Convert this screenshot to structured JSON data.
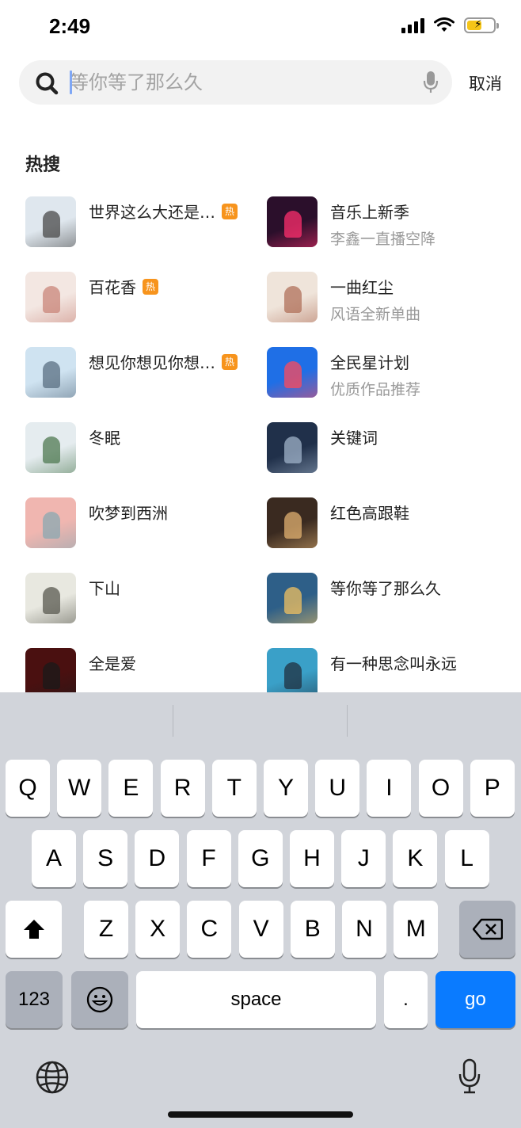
{
  "status": {
    "time": "2:49"
  },
  "search": {
    "placeholder": "等你等了那么久",
    "cancel_label": "取消"
  },
  "hot": {
    "title": "热搜",
    "badge_label": "热",
    "items": [
      {
        "title": "世界这么大还是…",
        "subtitle": "",
        "hot": true,
        "thumb_bg": "#dfe7ee",
        "thumb_accent": "#4a4a4a"
      },
      {
        "title": "音乐上新季",
        "subtitle": "李鑫一直播空降",
        "hot": false,
        "thumb_bg": "#2b0f2b",
        "thumb_accent": "#ff2f6d"
      },
      {
        "title": "百花香",
        "subtitle": "",
        "hot": true,
        "thumb_bg": "#f3e7e2",
        "thumb_accent": "#c9857a"
      },
      {
        "title": "一曲红尘",
        "subtitle": "风语全新单曲",
        "hot": false,
        "thumb_bg": "#efe4da",
        "thumb_accent": "#b0705a"
      },
      {
        "title": "想见你想见你想…",
        "subtitle": "",
        "hot": true,
        "thumb_bg": "#cfe3f1",
        "thumb_accent": "#5a6f82"
      },
      {
        "title": "全民星计划",
        "subtitle": "优质作品推荐",
        "hot": false,
        "thumb_bg": "#1f6fe6",
        "thumb_accent": "#ff4a5a"
      },
      {
        "title": "冬眠",
        "subtitle": "",
        "hot": false,
        "thumb_bg": "#e5ecef",
        "thumb_accent": "#4f7a52"
      },
      {
        "title": "关键词",
        "subtitle": "",
        "hot": false,
        "thumb_bg": "#20304a",
        "thumb_accent": "#9fb2c8"
      },
      {
        "title": "吹梦到西洲",
        "subtitle": "",
        "hot": false,
        "thumb_bg": "#f0b6b0",
        "thumb_accent": "#8aa8b2"
      },
      {
        "title": "红色高跟鞋",
        "subtitle": "",
        "hot": false,
        "thumb_bg": "#3a2a20",
        "thumb_accent": "#e0b070"
      },
      {
        "title": "下山",
        "subtitle": "",
        "hot": false,
        "thumb_bg": "#e8e8e0",
        "thumb_accent": "#5a5a50"
      },
      {
        "title": "等你等了那么久",
        "subtitle": "",
        "hot": false,
        "thumb_bg": "#2e5f88",
        "thumb_accent": "#f0c060"
      },
      {
        "title": "全是爱",
        "subtitle": "",
        "hot": false,
        "thumb_bg": "#4a1010",
        "thumb_accent": "#1a1a1a"
      },
      {
        "title": "有一种思念叫永远",
        "subtitle": "",
        "hot": false,
        "thumb_bg": "#3aa0c8",
        "thumb_accent": "#203040"
      }
    ]
  },
  "keyboard": {
    "row1": [
      "Q",
      "W",
      "E",
      "R",
      "T",
      "Y",
      "U",
      "I",
      "O",
      "P"
    ],
    "row2": [
      "A",
      "S",
      "D",
      "F",
      "G",
      "H",
      "J",
      "K",
      "L"
    ],
    "row3": [
      "Z",
      "X",
      "C",
      "V",
      "B",
      "N",
      "M"
    ],
    "numbers_label": "123",
    "space_label": "space",
    "period_label": ".",
    "go_label": "go"
  }
}
